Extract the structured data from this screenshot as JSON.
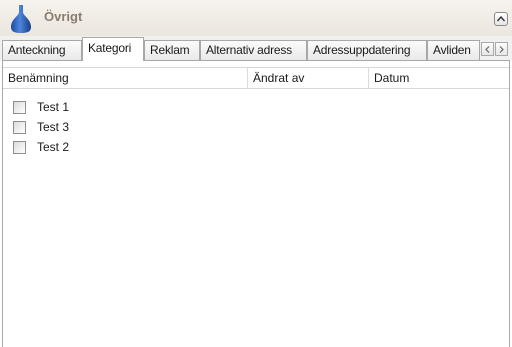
{
  "header": {
    "title": "Övrigt",
    "icon": "vase-icon",
    "collapse_icon": "chevron-up-icon"
  },
  "tabs": [
    {
      "label": "Anteckning",
      "active": false
    },
    {
      "label": "Kategori",
      "active": true
    },
    {
      "label": "Reklam",
      "active": false
    },
    {
      "label": "Alternativ adress",
      "active": false
    },
    {
      "label": "Adressuppdatering",
      "active": false
    },
    {
      "label": "Avliden",
      "active": false
    }
  ],
  "tab_scroll": {
    "left_icon": "arrow-left-icon",
    "right_icon": "arrow-right-icon"
  },
  "list": {
    "columns": [
      "Benämning",
      "Ändrat av",
      "Datum"
    ],
    "rows": [
      {
        "label": "Test 1",
        "checked": false
      },
      {
        "label": "Test 3",
        "checked": false
      },
      {
        "label": "Test 2",
        "checked": false
      }
    ]
  },
  "colors": {
    "header_title": "#8a7d6e",
    "icon_blue": "#2a5ab4",
    "border": "#a8a8a8"
  }
}
